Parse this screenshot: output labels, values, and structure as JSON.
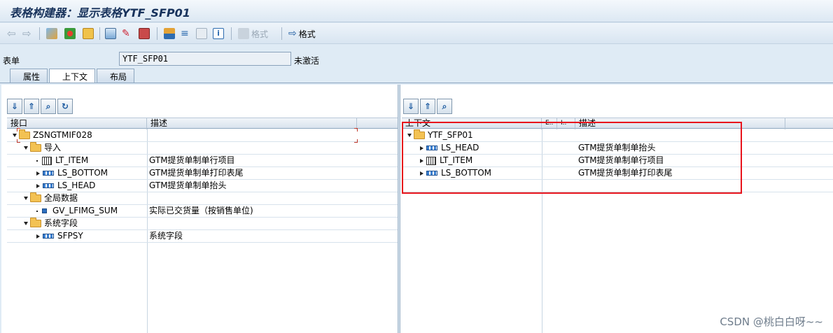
{
  "window": {
    "title": "表格构建器：显示表格YTF_SFP01"
  },
  "toolbar": {
    "disabled_style_label": "格式",
    "style_label": "格式"
  },
  "form": {
    "label": "表单",
    "value": "YTF_SFP01",
    "status": "未激活"
  },
  "tabs": [
    {
      "label": "属性"
    },
    {
      "label": "上下文"
    },
    {
      "label": "布局"
    }
  ],
  "left": {
    "columns": [
      "接口",
      "描述"
    ],
    "rows": [
      {
        "name": "ZSNGTMIF028",
        "desc": ""
      },
      {
        "name": "导入",
        "desc": ""
      },
      {
        "name": "LT_ITEM",
        "desc": "GTM提货单制单行项目"
      },
      {
        "name": "LS_BOTTOM",
        "desc": "GTM提货单制单打印表尾"
      },
      {
        "name": "LS_HEAD",
        "desc": "GTM提货单制单抬头"
      },
      {
        "name": "全局数据",
        "desc": ""
      },
      {
        "name": "GV_LFIMG_SUM",
        "desc": "实际已交货量（按销售单位)"
      },
      {
        "name": "系统字段",
        "desc": ""
      },
      {
        "name": "SFPSY",
        "desc": "系统字段"
      }
    ]
  },
  "right": {
    "columns": [
      "上下文",
      "E..",
      "I..",
      "描述"
    ],
    "rows": [
      {
        "name": "YTF_SFP01",
        "desc": ""
      },
      {
        "name": "LS_HEAD",
        "desc": "GTM提货单制单抬头"
      },
      {
        "name": "LT_ITEM",
        "desc": "GTM提货单制单行项目"
      },
      {
        "name": "LS_BOTTOM",
        "desc": "GTM提货单制单打印表尾"
      }
    ]
  },
  "watermark": "CSDN @桃白白呀~~"
}
